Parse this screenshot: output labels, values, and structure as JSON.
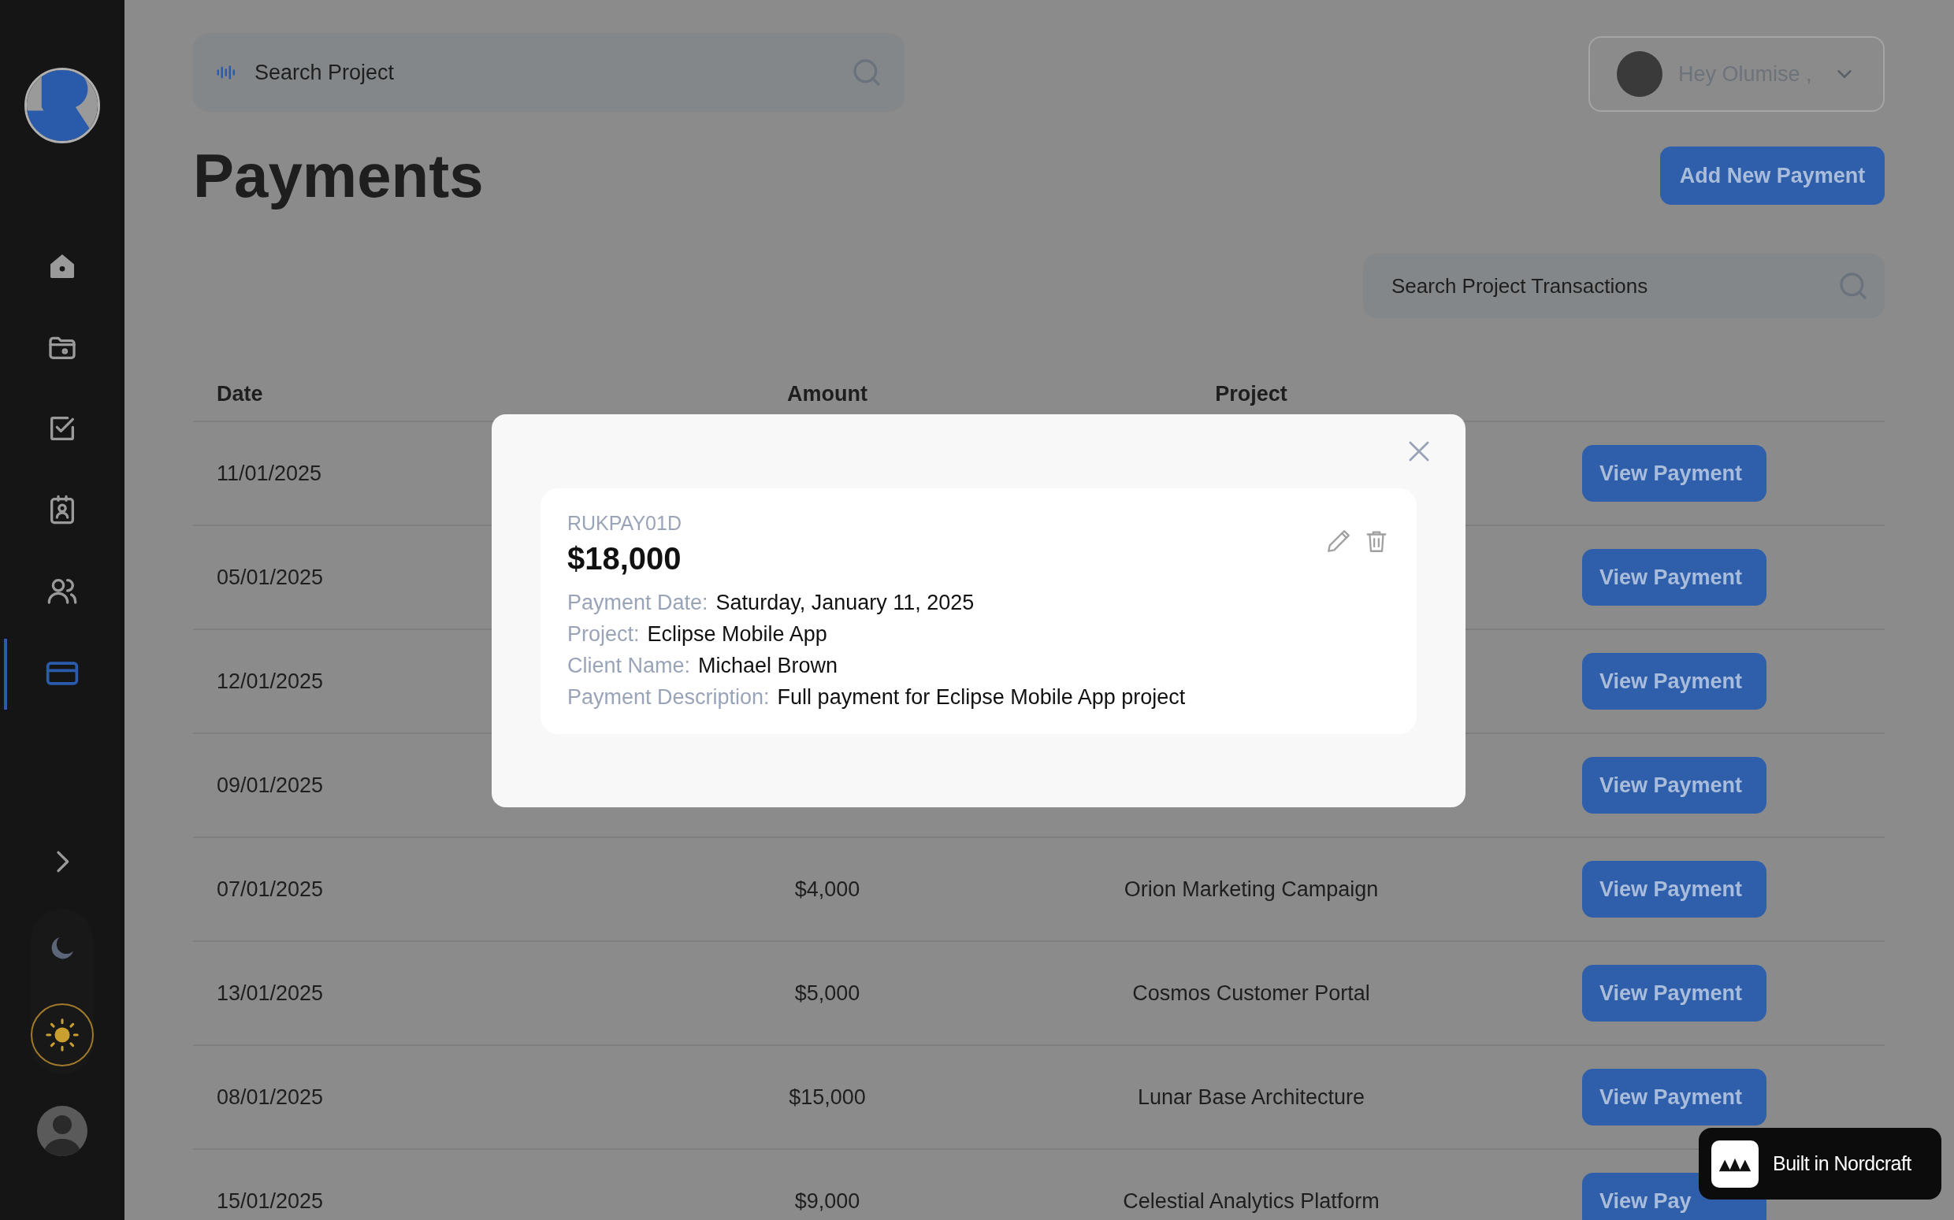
{
  "sidebar": {
    "nav": [
      {
        "kind": "home",
        "selected": false
      },
      {
        "kind": "folder",
        "selected": false
      },
      {
        "kind": "tasks",
        "selected": false
      },
      {
        "kind": "contacts",
        "selected": false
      },
      {
        "kind": "team",
        "selected": false
      },
      {
        "kind": "payments",
        "selected": true
      }
    ],
    "theme": [
      {
        "kind": "dark",
        "selected": false
      },
      {
        "kind": "light",
        "selected": true
      }
    ]
  },
  "search": {
    "placeholder": "Search Project"
  },
  "user_menu": {
    "greeting": "Hey Olumise ,"
  },
  "page_title": "Payments",
  "add_button": "Add New Payment",
  "transactions_search": {
    "placeholder": "Search Project Transactions"
  },
  "table": {
    "columns": [
      "Date",
      "Amount",
      "Project"
    ],
    "rows": [
      {
        "date": "11/01/2025",
        "action": "View Payment"
      },
      {
        "date": "05/01/2025",
        "action": "View Payment"
      },
      {
        "date": "12/01/2025",
        "action": "View Payment"
      },
      {
        "date": "09/01/2025",
        "action": "View Payment"
      },
      {
        "date": "07/01/2025",
        "amount": "$4,000",
        "project": "Orion Marketing Campaign",
        "action": "View Payment"
      },
      {
        "date": "13/01/2025",
        "amount": "$5,000",
        "project": "Cosmos Customer Portal",
        "action": "View Payment"
      },
      {
        "date": "08/01/2025",
        "amount": "$15,000",
        "project": "Lunar Base Architecture",
        "action": "View Payment"
      },
      {
        "date": "15/01/2025",
        "amount": "$9,000",
        "project": "Celestial Analytics Platform",
        "action": "View Pay"
      }
    ]
  },
  "modal": {
    "payment_id": "RUKPAY01D",
    "amount": "$18,000",
    "fields": [
      {
        "label": "Payment Date:",
        "value": "Saturday, January 11, 2025"
      },
      {
        "label": "Project:",
        "value": "Eclipse Mobile App"
      },
      {
        "label": "Client Name:",
        "value": "Michael Brown"
      },
      {
        "label": "Payment Description:",
        "value": "Full payment for Eclipse Mobile App project"
      }
    ]
  },
  "badge": "Built in Nordcraft"
}
